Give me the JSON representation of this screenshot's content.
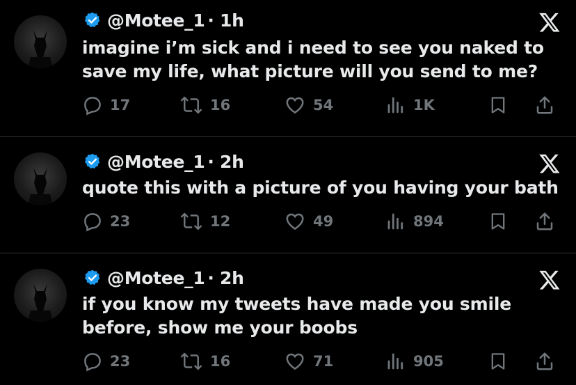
{
  "tweets": [
    {
      "handle": "@Motee_1",
      "time": "· 1h",
      "text_lines": [
        "imagine i’m sick and i need to see you naked to",
        "save my life, what picture will you send to me?"
      ],
      "replies": "17",
      "reposts": "16",
      "likes": "54",
      "views": "1K"
    },
    {
      "handle": "@Motee_1",
      "time": "· 2h",
      "text_lines": [
        "quote this with a picture of you having your bath"
      ],
      "replies": "23",
      "reposts": "12",
      "likes": "49",
      "views": "894"
    },
    {
      "handle": "@Motee_1",
      "time": "· 2h",
      "text_lines": [
        "if you know my tweets have made you smile",
        "before, show me your boobs"
      ],
      "replies": "23",
      "reposts": "16",
      "likes": "71",
      "views": "905"
    }
  ],
  "colors": {
    "background": "#000000",
    "text": "#e7e9ea",
    "muted": "#71767b",
    "verified": "#1d9bf0",
    "divider": "#2f3336"
  },
  "icons": {
    "verified": "verified-badge-icon",
    "platform": "x-logo-icon",
    "reply": "reply-icon",
    "repost": "repost-icon",
    "like": "heart-icon",
    "views": "views-icon",
    "bookmark": "bookmark-icon",
    "share": "share-icon"
  }
}
